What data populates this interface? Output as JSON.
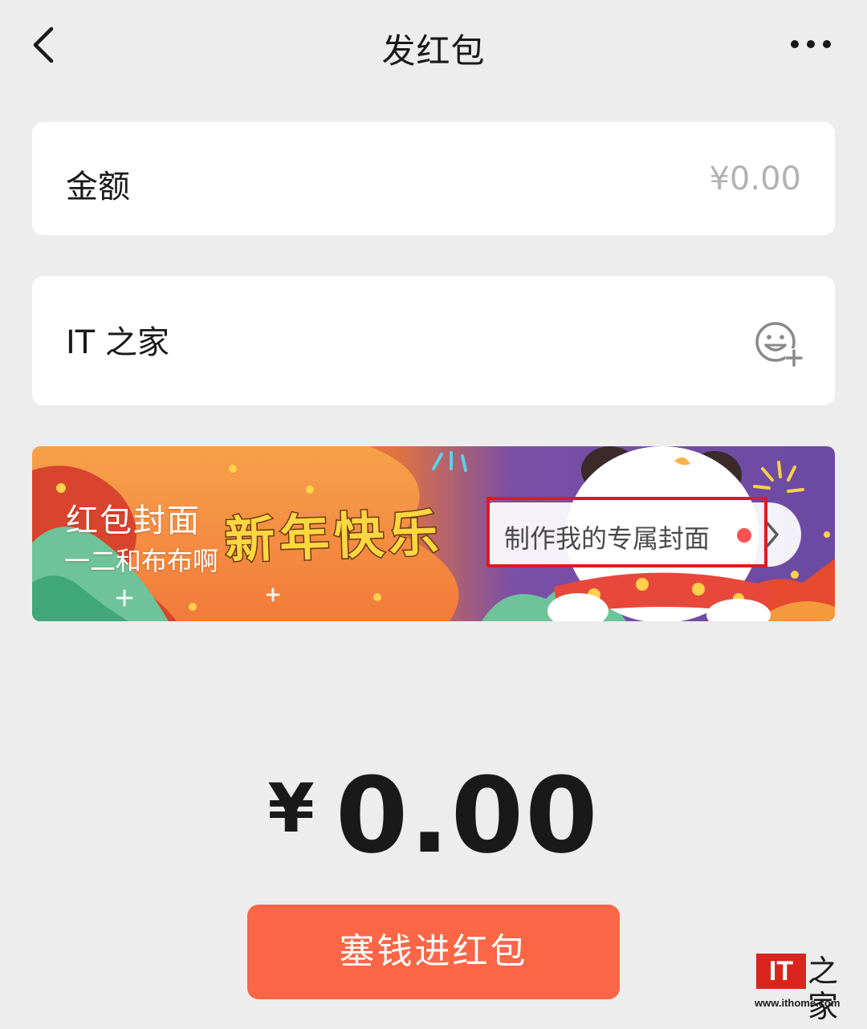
{
  "nav": {
    "title": "发红包",
    "back_icon": "chevron-left-icon",
    "more_icon": "ellipsis-icon"
  },
  "amount": {
    "label": "金额",
    "placeholder": "¥0.00"
  },
  "greeting": {
    "text": "IT 之家",
    "emoji_icon": "smile-add-icon"
  },
  "cover": {
    "label": "红包封面",
    "author": "一二和布布啊",
    "art_text": "新年快乐",
    "custom_label": "制作我的专属封面",
    "badge_color": "#fa5151"
  },
  "total": {
    "currency": "¥",
    "value": "0.00"
  },
  "submit": {
    "label": "塞钱进红包",
    "color": "#fa6646"
  },
  "watermark": {
    "logo": "IT",
    "glyph": "之家",
    "url": "www.ithome.com"
  }
}
